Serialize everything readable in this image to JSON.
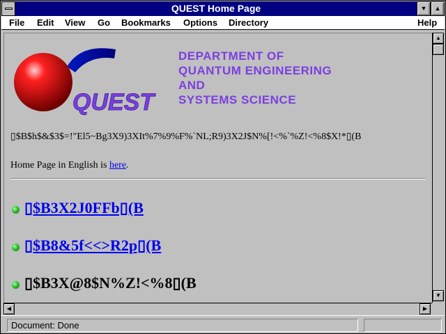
{
  "window": {
    "title": "QUEST Home Page"
  },
  "menubar": {
    "file": "File",
    "edit": "Edit",
    "view": "View",
    "go": "Go",
    "bookmarks": "Bookmarks",
    "options": "Options",
    "directory": "Directory",
    "help": "Help"
  },
  "header": {
    "logo_text": "QUEST",
    "dept_line1": "DEPARTMENT OF",
    "dept_line2": "QUANTUM ENGINEERING",
    "dept_line3": "AND",
    "dept_line4": "SYSTEMS SCIENCE"
  },
  "body": {
    "garbled_intro": "▯$B$h$&$3$=!\"El5~Bg3X9)3XIt%7%9%F%`NL;R9)3X2J$N%[!<%`%Z!<%8$X!*▯(B",
    "english_prefix": "Home Page in English is ",
    "english_link": "here",
    "english_suffix": ".",
    "items": [
      {
        "label": "▯$B3X2J0FFb▯(B",
        "is_link": true
      },
      {
        "label": "▯$B8&5f<<>R2p▯(B",
        "is_link": true
      },
      {
        "label": "▯$B3X@8$N%Z!<%8▯(B",
        "is_link": false
      }
    ]
  },
  "status": {
    "text": "Document: Done"
  },
  "colors": {
    "title_bar": "#000080",
    "dept_text": "#7b3fe0",
    "link": "#0000ee",
    "logo_sphere": "#e00000",
    "logo_swoosh": "#0018c0"
  },
  "icons": {
    "bullet": "green-sphere-bullet",
    "minimize": "triangle-down-icon",
    "maximize": "triangle-up-icon"
  }
}
